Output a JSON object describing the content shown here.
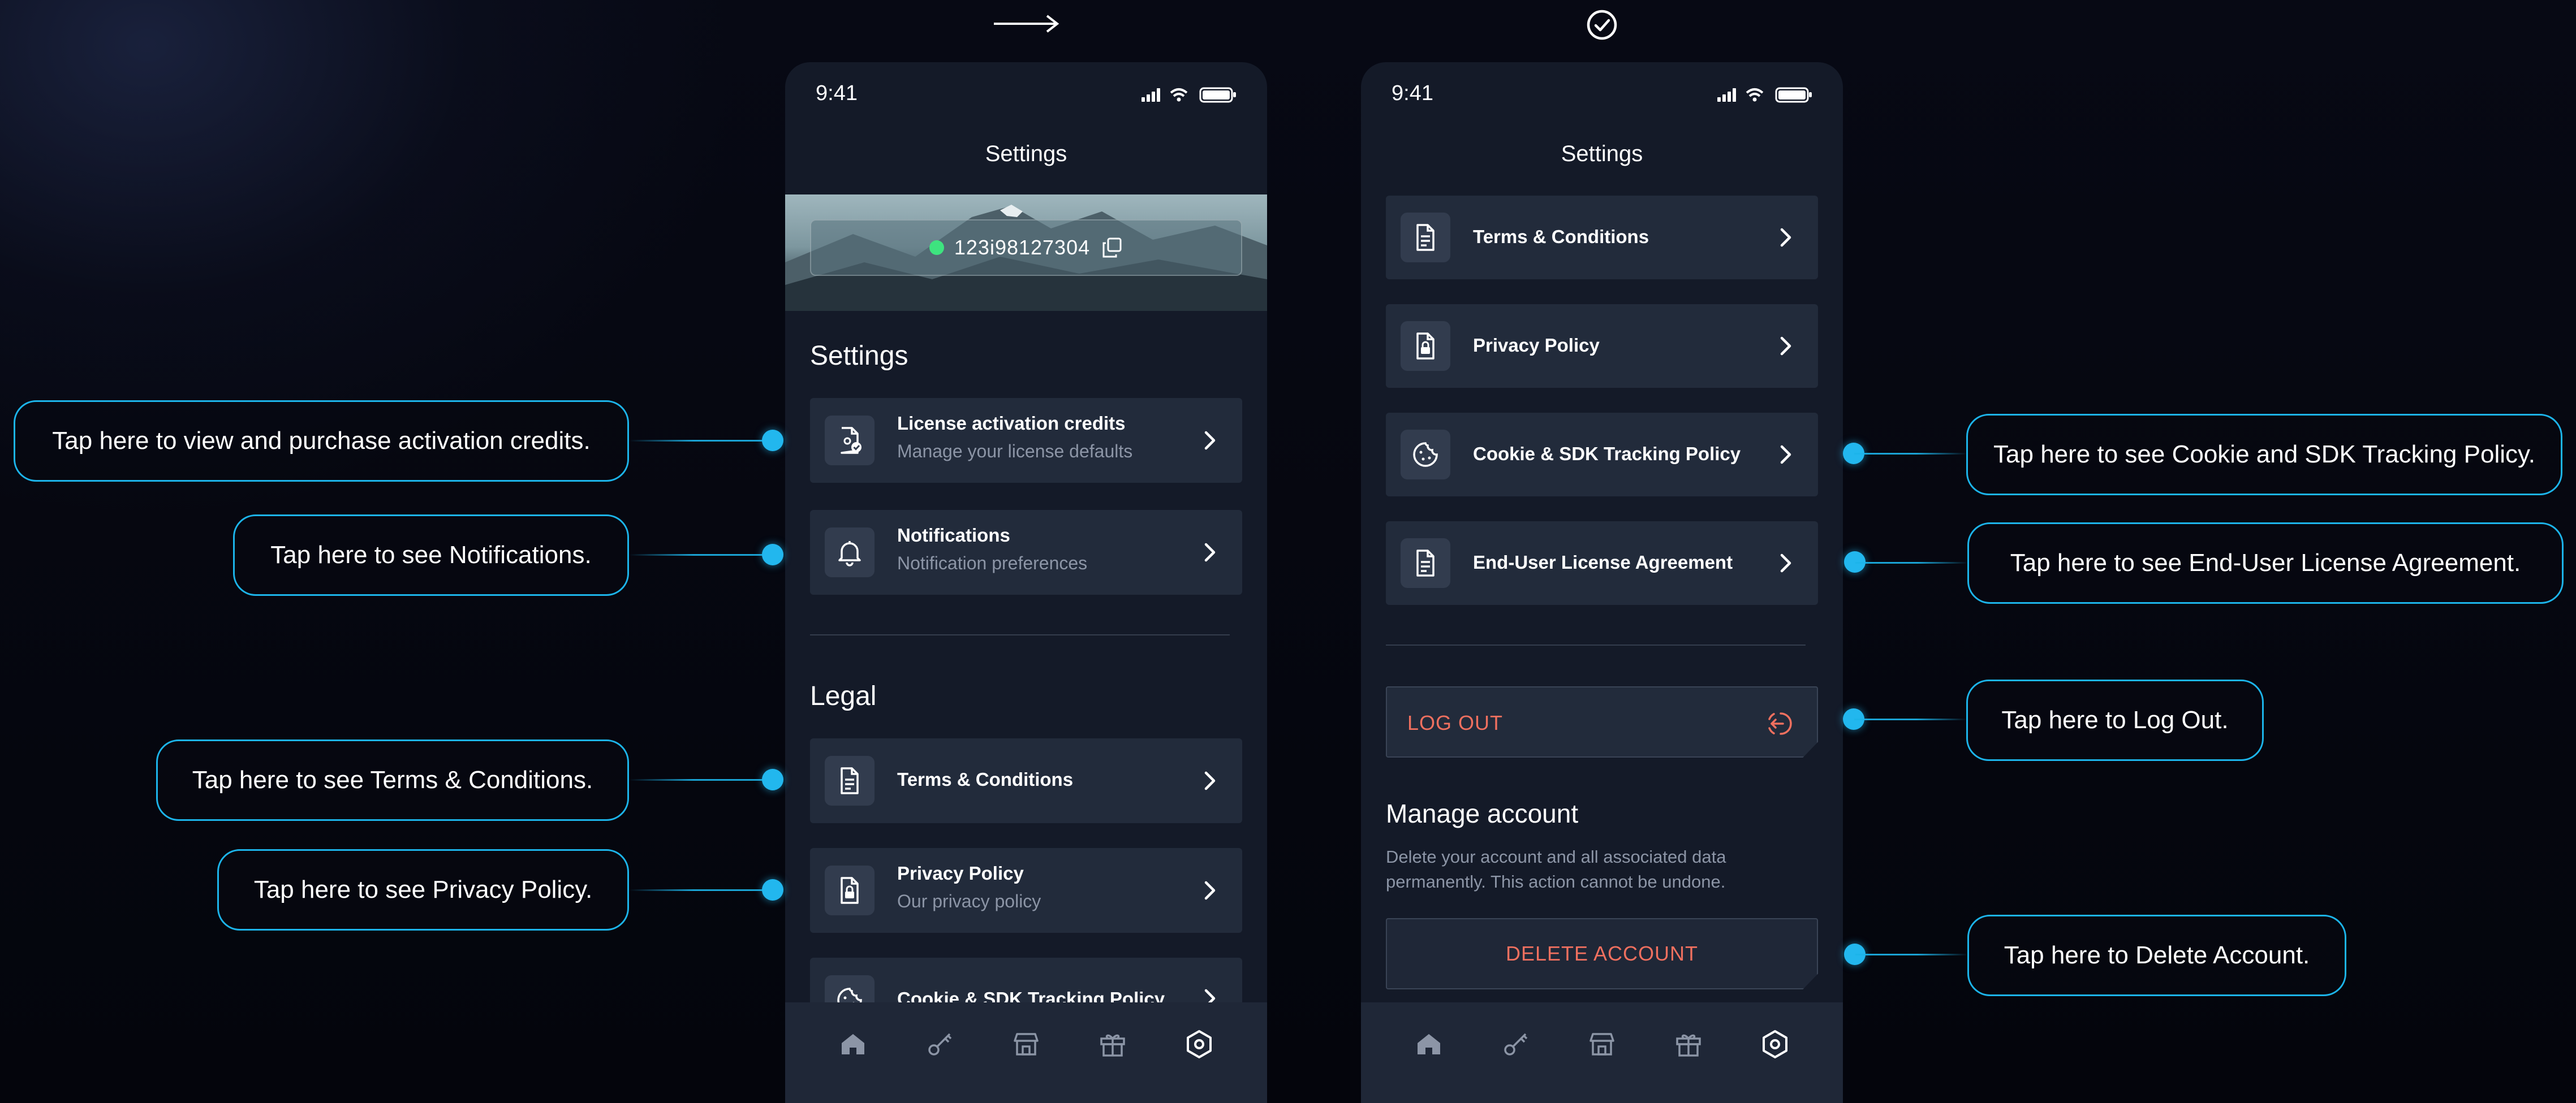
{
  "indicators": {
    "left": "arrow-right-icon",
    "right": "check-circle-icon"
  },
  "status_bar": {
    "time": "9:41"
  },
  "left_screen": {
    "title": "Settings",
    "license_id": "123i98127304",
    "settings_heading": "Settings",
    "settings_items": [
      {
        "title": "License activation credits",
        "subtitle": "Manage your license defaults",
        "icon": "license-file-icon"
      },
      {
        "title": "Notifications",
        "subtitle": "Notification preferences",
        "icon": "bell-icon"
      }
    ],
    "legal_heading": "Legal",
    "legal_items": [
      {
        "title": "Terms & Conditions",
        "subtitle": "",
        "icon": "document-icon"
      },
      {
        "title": "Privacy Policy",
        "subtitle": "Our privacy policy",
        "icon": "lock-document-icon"
      },
      {
        "title": "Cookie & SDK Tracking Policy",
        "subtitle": "",
        "icon": "cookie-icon"
      }
    ]
  },
  "right_screen": {
    "title": "Settings",
    "legal_items": [
      {
        "title": "Terms & Conditions",
        "icon": "document-icon"
      },
      {
        "title": "Privacy Policy",
        "icon": "lock-document-icon"
      },
      {
        "title": "Cookie & SDK Tracking Policy",
        "icon": "cookie-icon"
      },
      {
        "title": "End-User License Agreement",
        "icon": "document-icon"
      }
    ],
    "logout_label": "LOG OUT",
    "manage_heading": "Manage account",
    "manage_description": "Delete your account and all associated data permanently. This action cannot be undone.",
    "delete_label": "DELETE ACCOUNT"
  },
  "tabbar": {
    "tabs": [
      "home-icon",
      "key-icon",
      "store-icon",
      "gift-icon",
      "settings-hex-icon"
    ],
    "active": 4
  },
  "callouts": {
    "activation_credits": "Tap here to view and purchase activation credits.",
    "notifications": "Tap here to see Notifications.",
    "terms": "Tap here to see Terms & Conditions.",
    "privacy": "Tap here to see Privacy Policy.",
    "cookie": "Tap here to see Cookie and SDK Tracking Policy.",
    "eula": "Tap here to see End-User License Agreement.",
    "logout": "Tap here to Log Out.",
    "delete": "Tap here to Delete Account."
  },
  "colors": {
    "accent": "#1cb4ea",
    "danger": "#f0705f",
    "online": "#3ee37f",
    "card": "#222b3b",
    "background": "#141a28"
  }
}
